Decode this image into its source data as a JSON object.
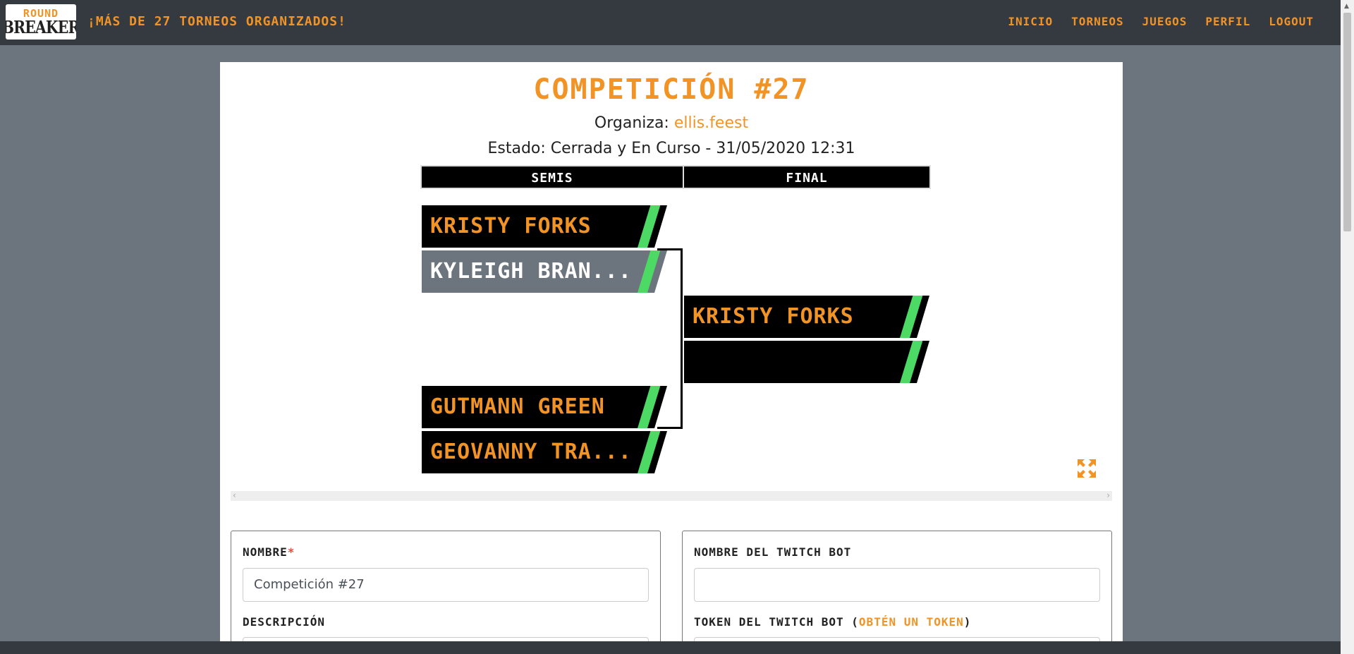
{
  "navbar": {
    "logo_top": "ROUND",
    "logo_bottom": "BREAKER",
    "tagline": "¡MÁS DE 27 TORNEOS ORGANIZADOS!",
    "links": [
      "INICIO",
      "TORNEOS",
      "JUEGOS",
      "PERFIL",
      "LOGOUT"
    ]
  },
  "tournament": {
    "title": "COMPETICIÓN #27",
    "organizer_label": "Organiza:",
    "organizer_user": "ellis.feest",
    "status": "Estado: Cerrada y En Curso - 31/05/2020 12:31"
  },
  "bracket": {
    "rounds": [
      "SEMIS",
      "FINAL"
    ],
    "semis": [
      {
        "name": "KRISTY FORKS",
        "style": "black"
      },
      {
        "name": "KYLEIGH BRAN...",
        "style": "gray"
      },
      {
        "name": "GUTMANN GREEN",
        "style": "black"
      },
      {
        "name": "GEOVANNY TRA...",
        "style": "black"
      }
    ],
    "final": [
      {
        "name": "KRISTY FORKS",
        "style": "black"
      },
      {
        "name": "",
        "style": "black"
      }
    ],
    "accent": "#4cd964"
  },
  "form": {
    "nombre_label": "NOMBRE",
    "nombre_required": "*",
    "nombre_value": "Competición #27",
    "descripcion_label": "DESCRIPCIÓN",
    "bot_name_label": "NOMBRE DEL TWITCH BOT",
    "bot_name_value": "",
    "token_label": "TOKEN DEL TWITCH BOT",
    "token_link": "OBTÉN UN TOKEN"
  },
  "colors": {
    "accent": "#f29325",
    "navbar": "#343a40",
    "background": "#6c757d"
  }
}
